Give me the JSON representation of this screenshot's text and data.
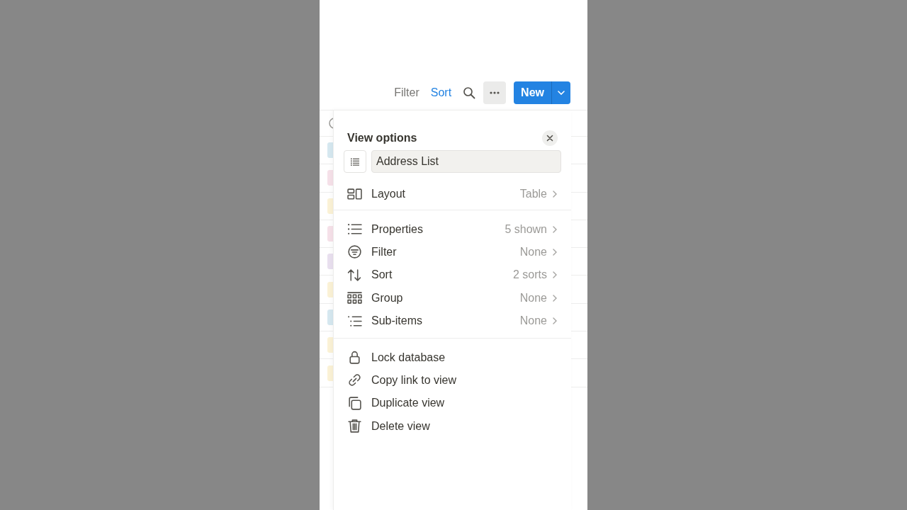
{
  "toolbar": {
    "filter": "Filter",
    "sort": "Sort",
    "sort_active": true,
    "new_button": "New"
  },
  "table": {
    "rows": [
      {
        "color": "#d6e8f0"
      },
      {
        "color": "#f6e1e9"
      },
      {
        "color": "#fbf2d6"
      },
      {
        "color": "#f6e1e9"
      },
      {
        "color": "#e9e0ef"
      },
      {
        "color": "#fbf2d6"
      },
      {
        "color": "#d6e8f0"
      },
      {
        "color": "#fbf2d6"
      },
      {
        "color": "#fbf2d6"
      }
    ]
  },
  "panel": {
    "title": "View options",
    "view_name": "Address List",
    "sections": [
      [
        {
          "label": "Layout",
          "value": "Table"
        }
      ],
      [
        {
          "label": "Properties",
          "value": "5 shown"
        },
        {
          "label": "Filter",
          "value": "None"
        },
        {
          "label": "Sort",
          "value": "2 sorts"
        },
        {
          "label": "Group",
          "value": "None"
        },
        {
          "label": "Sub-items",
          "value": "None"
        }
      ],
      [
        {
          "label": "Lock database"
        },
        {
          "label": "Copy link to view"
        },
        {
          "label": "Duplicate view"
        },
        {
          "label": "Delete view"
        }
      ]
    ]
  }
}
